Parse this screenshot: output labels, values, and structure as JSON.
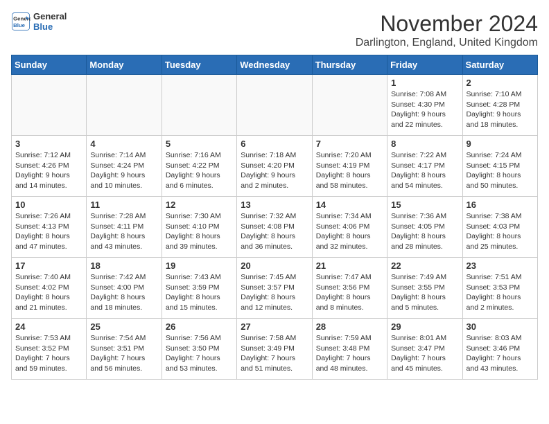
{
  "logo": {
    "line1": "General",
    "line2": "Blue"
  },
  "title": "November 2024",
  "location": "Darlington, England, United Kingdom",
  "days_of_week": [
    "Sunday",
    "Monday",
    "Tuesday",
    "Wednesday",
    "Thursday",
    "Friday",
    "Saturday"
  ],
  "weeks": [
    [
      {
        "day": "",
        "info": ""
      },
      {
        "day": "",
        "info": ""
      },
      {
        "day": "",
        "info": ""
      },
      {
        "day": "",
        "info": ""
      },
      {
        "day": "",
        "info": ""
      },
      {
        "day": "1",
        "info": "Sunrise: 7:08 AM\nSunset: 4:30 PM\nDaylight: 9 hours and 22 minutes."
      },
      {
        "day": "2",
        "info": "Sunrise: 7:10 AM\nSunset: 4:28 PM\nDaylight: 9 hours and 18 minutes."
      }
    ],
    [
      {
        "day": "3",
        "info": "Sunrise: 7:12 AM\nSunset: 4:26 PM\nDaylight: 9 hours and 14 minutes."
      },
      {
        "day": "4",
        "info": "Sunrise: 7:14 AM\nSunset: 4:24 PM\nDaylight: 9 hours and 10 minutes."
      },
      {
        "day": "5",
        "info": "Sunrise: 7:16 AM\nSunset: 4:22 PM\nDaylight: 9 hours and 6 minutes."
      },
      {
        "day": "6",
        "info": "Sunrise: 7:18 AM\nSunset: 4:20 PM\nDaylight: 9 hours and 2 minutes."
      },
      {
        "day": "7",
        "info": "Sunrise: 7:20 AM\nSunset: 4:19 PM\nDaylight: 8 hours and 58 minutes."
      },
      {
        "day": "8",
        "info": "Sunrise: 7:22 AM\nSunset: 4:17 PM\nDaylight: 8 hours and 54 minutes."
      },
      {
        "day": "9",
        "info": "Sunrise: 7:24 AM\nSunset: 4:15 PM\nDaylight: 8 hours and 50 minutes."
      }
    ],
    [
      {
        "day": "10",
        "info": "Sunrise: 7:26 AM\nSunset: 4:13 PM\nDaylight: 8 hours and 47 minutes."
      },
      {
        "day": "11",
        "info": "Sunrise: 7:28 AM\nSunset: 4:11 PM\nDaylight: 8 hours and 43 minutes."
      },
      {
        "day": "12",
        "info": "Sunrise: 7:30 AM\nSunset: 4:10 PM\nDaylight: 8 hours and 39 minutes."
      },
      {
        "day": "13",
        "info": "Sunrise: 7:32 AM\nSunset: 4:08 PM\nDaylight: 8 hours and 36 minutes."
      },
      {
        "day": "14",
        "info": "Sunrise: 7:34 AM\nSunset: 4:06 PM\nDaylight: 8 hours and 32 minutes."
      },
      {
        "day": "15",
        "info": "Sunrise: 7:36 AM\nSunset: 4:05 PM\nDaylight: 8 hours and 28 minutes."
      },
      {
        "day": "16",
        "info": "Sunrise: 7:38 AM\nSunset: 4:03 PM\nDaylight: 8 hours and 25 minutes."
      }
    ],
    [
      {
        "day": "17",
        "info": "Sunrise: 7:40 AM\nSunset: 4:02 PM\nDaylight: 8 hours and 21 minutes."
      },
      {
        "day": "18",
        "info": "Sunrise: 7:42 AM\nSunset: 4:00 PM\nDaylight: 8 hours and 18 minutes."
      },
      {
        "day": "19",
        "info": "Sunrise: 7:43 AM\nSunset: 3:59 PM\nDaylight: 8 hours and 15 minutes."
      },
      {
        "day": "20",
        "info": "Sunrise: 7:45 AM\nSunset: 3:57 PM\nDaylight: 8 hours and 12 minutes."
      },
      {
        "day": "21",
        "info": "Sunrise: 7:47 AM\nSunset: 3:56 PM\nDaylight: 8 hours and 8 minutes."
      },
      {
        "day": "22",
        "info": "Sunrise: 7:49 AM\nSunset: 3:55 PM\nDaylight: 8 hours and 5 minutes."
      },
      {
        "day": "23",
        "info": "Sunrise: 7:51 AM\nSunset: 3:53 PM\nDaylight: 8 hours and 2 minutes."
      }
    ],
    [
      {
        "day": "24",
        "info": "Sunrise: 7:53 AM\nSunset: 3:52 PM\nDaylight: 7 hours and 59 minutes."
      },
      {
        "day": "25",
        "info": "Sunrise: 7:54 AM\nSunset: 3:51 PM\nDaylight: 7 hours and 56 minutes."
      },
      {
        "day": "26",
        "info": "Sunrise: 7:56 AM\nSunset: 3:50 PM\nDaylight: 7 hours and 53 minutes."
      },
      {
        "day": "27",
        "info": "Sunrise: 7:58 AM\nSunset: 3:49 PM\nDaylight: 7 hours and 51 minutes."
      },
      {
        "day": "28",
        "info": "Sunrise: 7:59 AM\nSunset: 3:48 PM\nDaylight: 7 hours and 48 minutes."
      },
      {
        "day": "29",
        "info": "Sunrise: 8:01 AM\nSunset: 3:47 PM\nDaylight: 7 hours and 45 minutes."
      },
      {
        "day": "30",
        "info": "Sunrise: 8:03 AM\nSunset: 3:46 PM\nDaylight: 7 hours and 43 minutes."
      }
    ]
  ]
}
